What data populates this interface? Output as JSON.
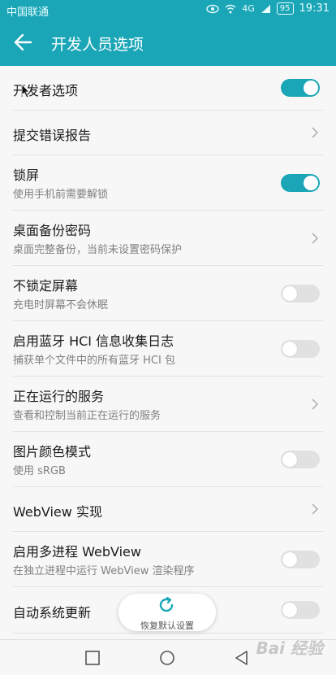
{
  "status_bar": {
    "carrier": "中国联通",
    "signal": "4G",
    "battery": "95",
    "time": "19:31"
  },
  "header": {
    "title": "开发人员选项"
  },
  "settings": [
    {
      "title": "开发者选项",
      "subtitle": "",
      "control": "toggle",
      "on": true
    },
    {
      "title": "提交错误报告",
      "subtitle": "",
      "control": "chevron"
    },
    {
      "title": "锁屏",
      "subtitle": "使用手机前需要解锁",
      "control": "toggle",
      "on": true
    },
    {
      "title": "桌面备份密码",
      "subtitle": "桌面完整备份，当前未设置密码保护",
      "control": "chevron"
    },
    {
      "title": "不锁定屏幕",
      "subtitle": "充电时屏幕不会休眠",
      "control": "toggle",
      "on": false
    },
    {
      "title": "启用蓝牙 HCI 信息收集日志",
      "subtitle": "捕获单个文件中的所有蓝牙 HCI 包",
      "control": "toggle",
      "on": false
    },
    {
      "title": "正在运行的服务",
      "subtitle": "查看和控制当前正在运行的服务",
      "control": "chevron"
    },
    {
      "title": "图片颜色模式",
      "subtitle": "使用 sRGB",
      "control": "toggle",
      "on": false
    },
    {
      "title": "WebView 实现",
      "subtitle": "",
      "control": "chevron"
    },
    {
      "title": "启用多进程 WebView",
      "subtitle": "在独立进程中运行 WebView 渲染程序",
      "control": "toggle",
      "on": false
    },
    {
      "title": "自动系统更新",
      "subtitle": "",
      "control": "toggle",
      "on": false
    }
  ],
  "restore_button": {
    "label": "恢复默认设置"
  },
  "watermark": "Bai 经验",
  "colors": {
    "accent": "#1aa6b7",
    "toggle_off": "#e1e1e1",
    "background": "#f7f7f7"
  },
  "icons": {
    "back": "arrow-left-icon",
    "restore": "refresh-icon",
    "nav_back": "triangle-back-icon",
    "nav_home": "circle-home-icon",
    "nav_recent": "square-recent-icon"
  }
}
